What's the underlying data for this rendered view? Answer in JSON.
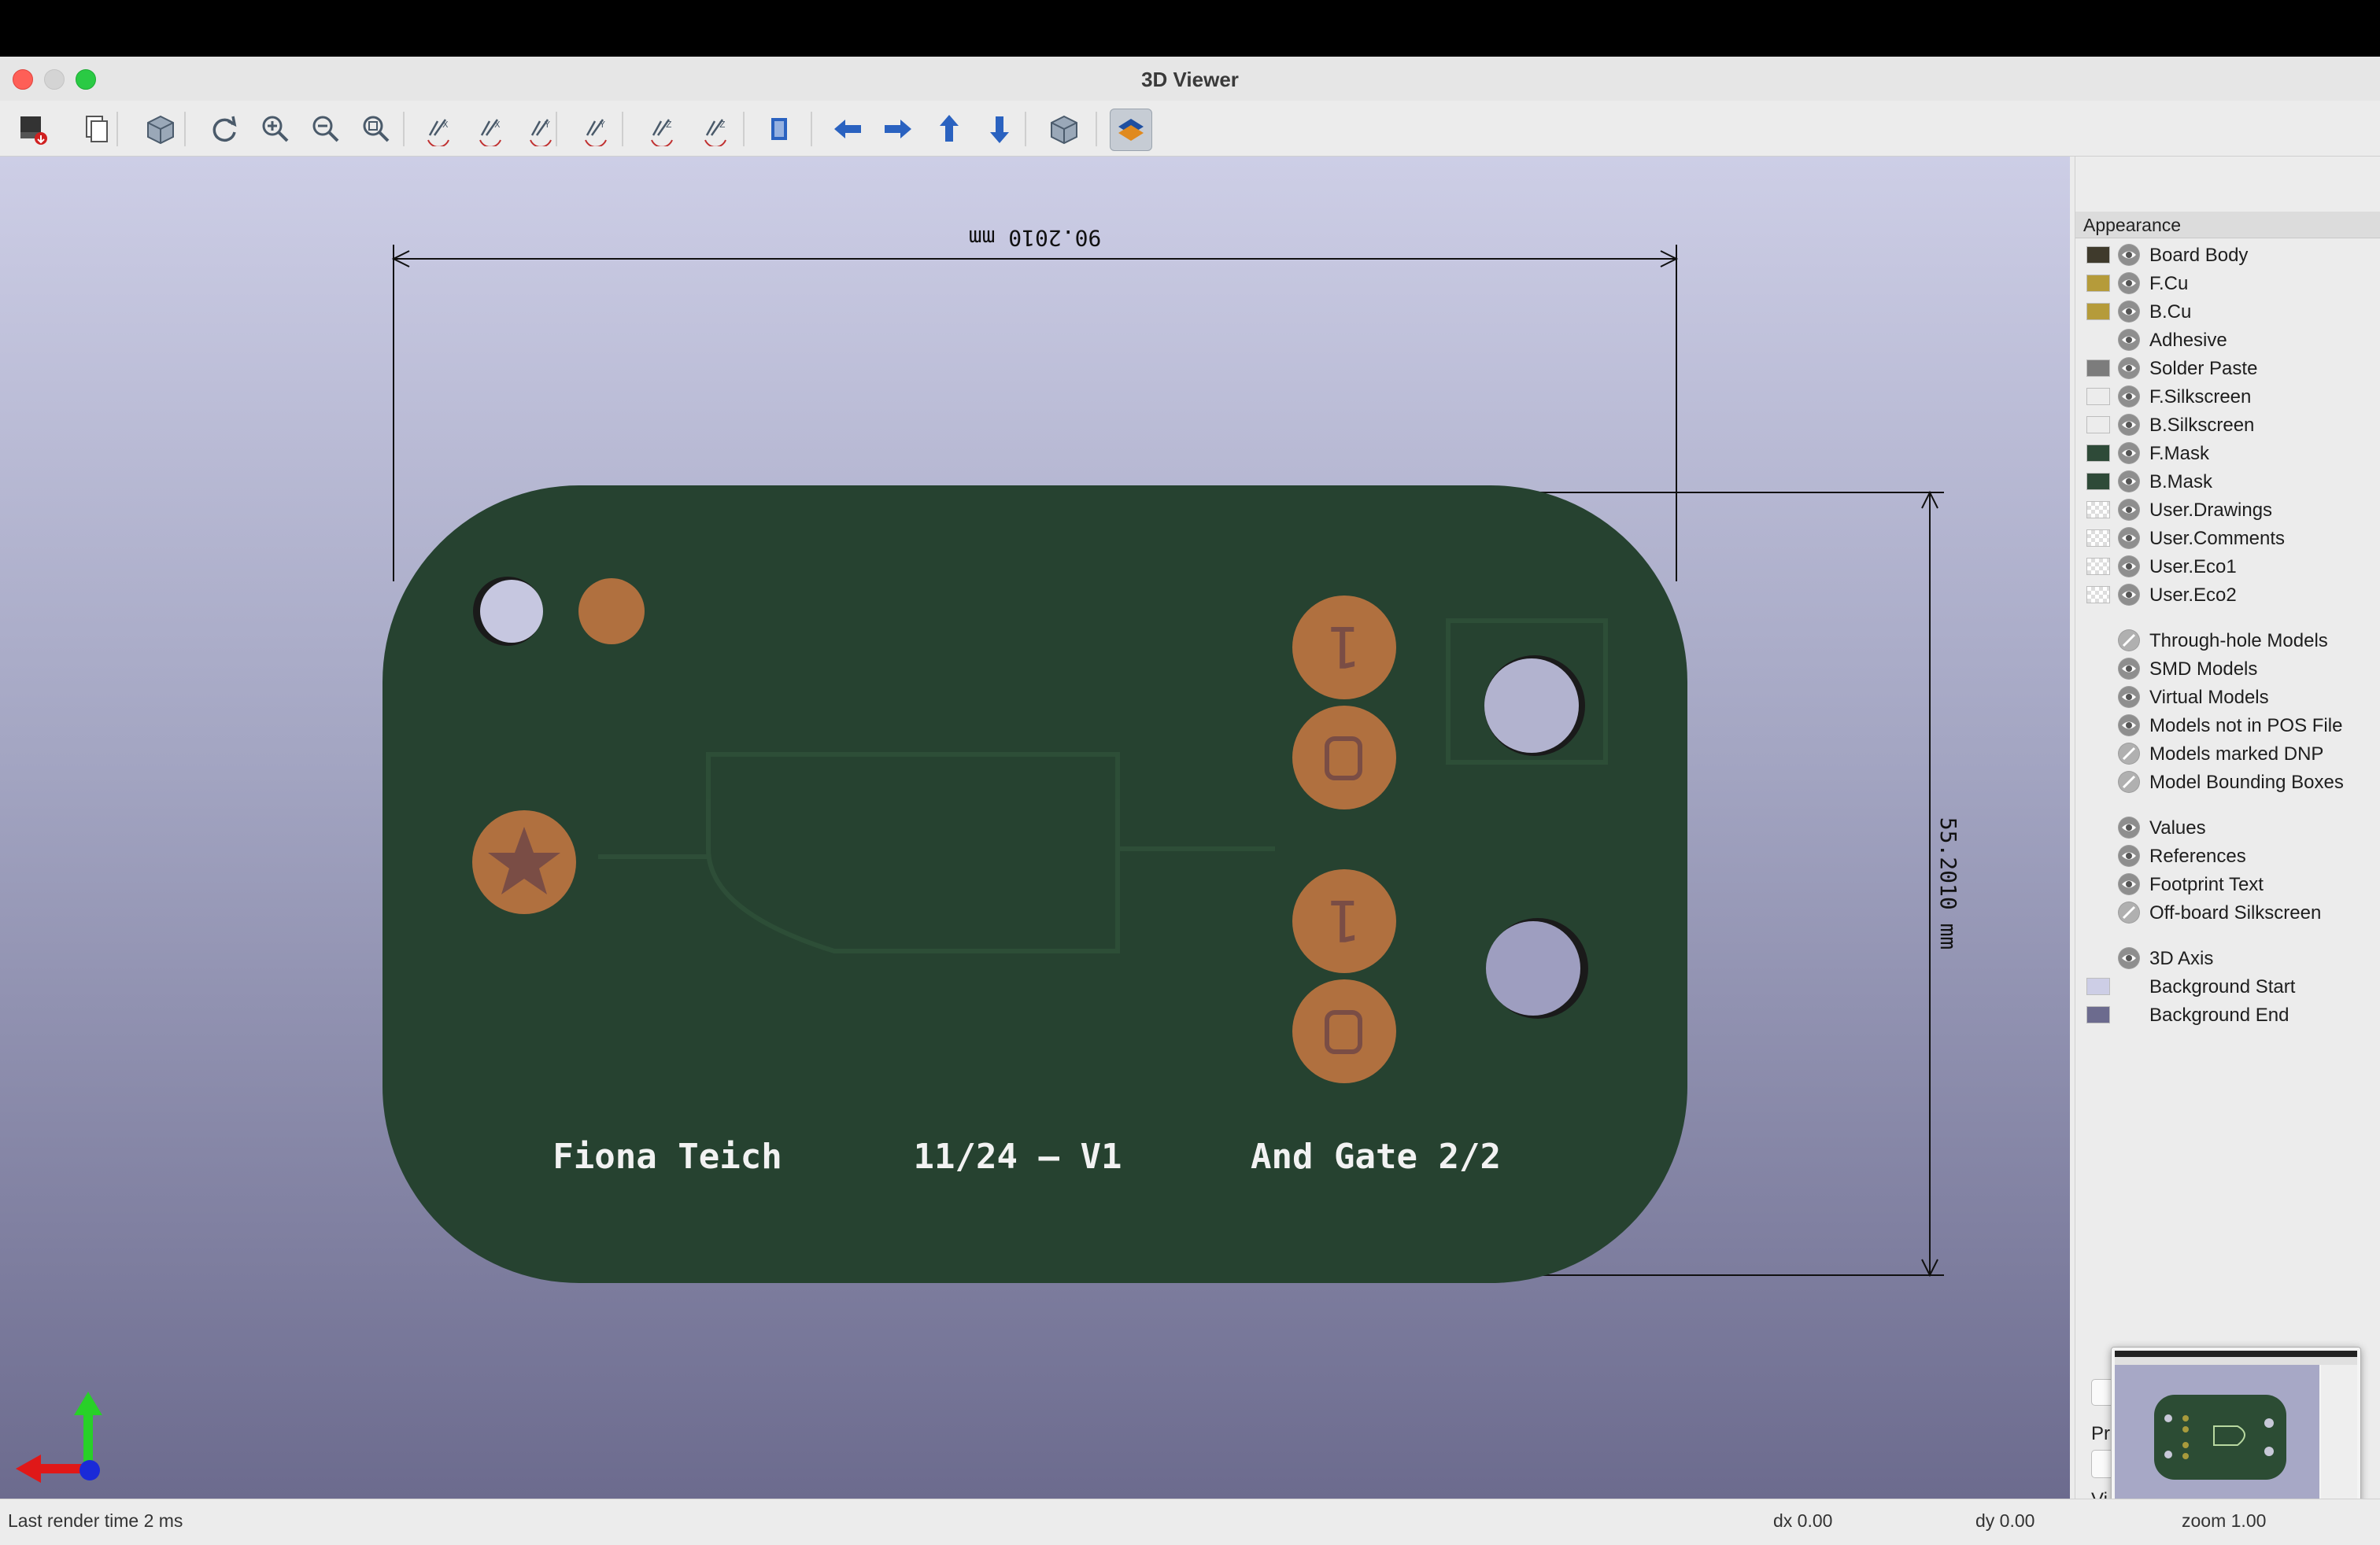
{
  "window": {
    "title": "3D Viewer"
  },
  "toolbar": {
    "buttons": [
      {
        "name": "export-icon"
      },
      {
        "name": "copy-icon"
      },
      {
        "name": "view3d-icon"
      },
      {
        "name": "reload-icon"
      },
      {
        "name": "zoom-in-icon"
      },
      {
        "name": "zoom-out-icon"
      },
      {
        "name": "zoom-fit-icon"
      },
      {
        "name": "rotate-x-cw-icon"
      },
      {
        "name": "rotate-x-ccw-icon"
      },
      {
        "name": "rotate-y-cw-icon"
      },
      {
        "name": "rotate-y-ccw-icon"
      },
      {
        "name": "rotate-z-cw-icon"
      },
      {
        "name": "rotate-z-ccw-icon"
      },
      {
        "name": "flip-board-icon"
      },
      {
        "name": "move-left-icon"
      },
      {
        "name": "move-right-icon"
      },
      {
        "name": "move-up-icon"
      },
      {
        "name": "move-down-icon"
      },
      {
        "name": "ortho-icon"
      },
      {
        "name": "layers-icon"
      }
    ]
  },
  "viewport": {
    "width_label": "90.2010 mm",
    "height_label": "55.2010 mm",
    "silkscreen": {
      "name": "Fiona Teich",
      "version": "11/24 — V1",
      "title": "And Gate 2/2"
    },
    "pad_labels": [
      "1",
      "1"
    ],
    "colors": {
      "board": "#264230",
      "pad": "#b0703f",
      "bg_start": "#cdcee6",
      "bg_end": "#6c6b8e"
    }
  },
  "appearance": {
    "header": "Appearance",
    "layers": [
      {
        "label": "Board Body",
        "color": "#3f3a2c"
      },
      {
        "label": "F.Cu",
        "color": "#b59b3a"
      },
      {
        "label": "B.Cu",
        "color": "#b59b3a"
      },
      {
        "label": "Adhesive",
        "color": ""
      },
      {
        "label": "Solder Paste",
        "color": "#7c7c7c"
      },
      {
        "label": "F.Silkscreen",
        "color": "#ececec"
      },
      {
        "label": "B.Silkscreen",
        "color": "#ececec"
      },
      {
        "label": "F.Mask",
        "color": "#2e4a38"
      },
      {
        "label": "B.Mask",
        "color": "#2e4a38"
      },
      {
        "label": "User.Drawings",
        "color": "checker"
      },
      {
        "label": "User.Comments",
        "color": "checker"
      },
      {
        "label": "User.Eco1",
        "color": "checker"
      },
      {
        "label": "User.Eco2",
        "color": "checker"
      }
    ],
    "models": [
      {
        "label": "Through-hole Models",
        "visible": false
      },
      {
        "label": "SMD Models",
        "visible": true
      },
      {
        "label": "Virtual Models",
        "visible": true
      },
      {
        "label": "Models not in POS File",
        "visible": true
      },
      {
        "label": "Models marked DNP",
        "visible": false
      },
      {
        "label": "Model Bounding Boxes",
        "visible": false
      }
    ],
    "text_items": [
      {
        "label": "Values",
        "visible": true
      },
      {
        "label": "References",
        "visible": true
      },
      {
        "label": "Footprint Text",
        "visible": true
      },
      {
        "label": "Off-board Silkscreen",
        "visible": false
      }
    ],
    "misc": [
      {
        "label": "3D Axis",
        "color": "",
        "icon": true
      },
      {
        "label": "Background Start",
        "color": "#cdcee6",
        "icon": false
      },
      {
        "label": "Background End",
        "color": "#6c6b8e",
        "icon": false
      }
    ],
    "fragments": {
      "presets_prefix": "Pr",
      "viewports_prefix": "Vi"
    }
  },
  "status": {
    "render_time": "Last render time 2 ms",
    "dx": "dx 0.00",
    "dy": "dy 0.00",
    "zoom": "zoom 1.00"
  }
}
